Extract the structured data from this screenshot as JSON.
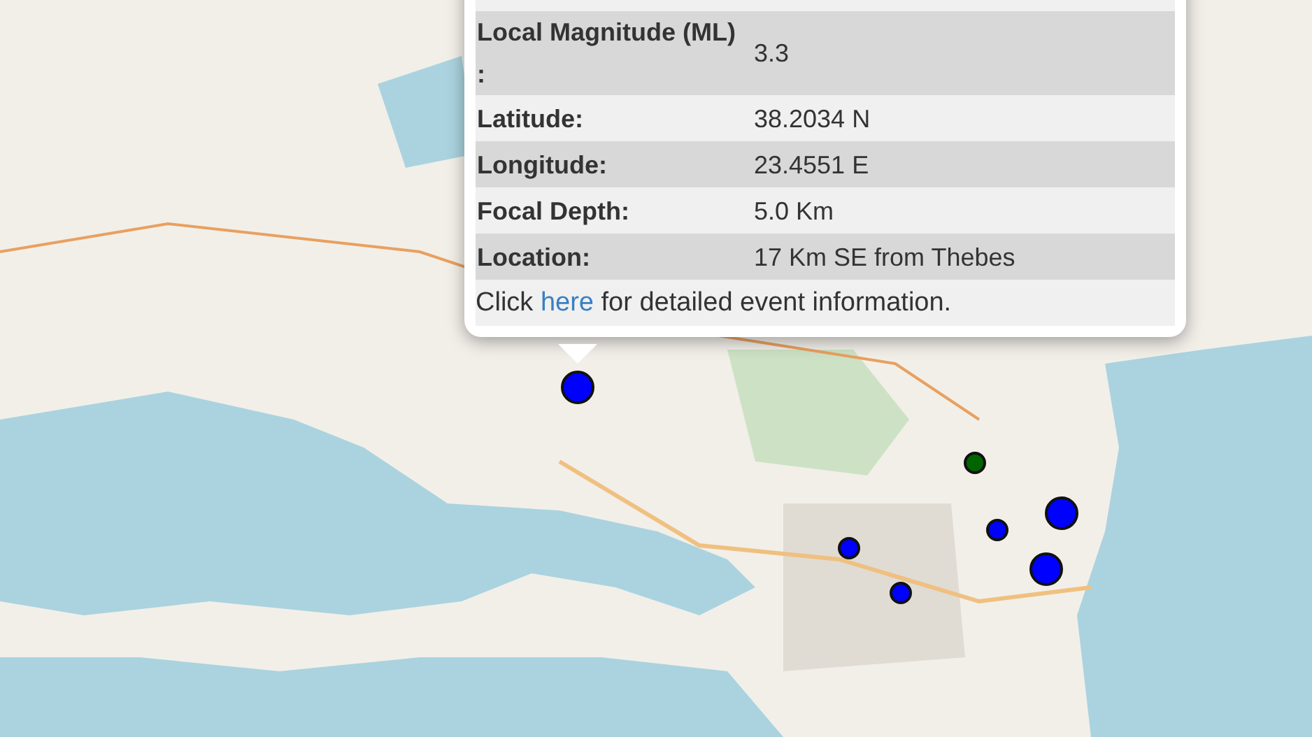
{
  "popup": {
    "rows": [
      {
        "label": "Local Magnitude (ML) :",
        "value": "3.3"
      },
      {
        "label": "Latitude:",
        "value": "38.2034 N"
      },
      {
        "label": "Longitude:",
        "value": "23.4551 E"
      },
      {
        "label": "Focal Depth:",
        "value": "5.0 Km"
      },
      {
        "label": "Location:",
        "value": "17 Km SE from Thebes"
      }
    ],
    "footer": {
      "before": "Click ",
      "link": "here",
      "after": " for detailed event information."
    }
  },
  "markers": [
    {
      "kind": "large",
      "color": "#0000ff"
    },
    {
      "kind": "small",
      "color": "#006400"
    },
    {
      "kind": "large",
      "color": "#0000ff"
    },
    {
      "kind": "small",
      "color": "#0000ff"
    },
    {
      "kind": "small",
      "color": "#0000ff"
    },
    {
      "kind": "large",
      "color": "#0000ff"
    },
    {
      "kind": "small",
      "color": "#0000ff"
    }
  ]
}
